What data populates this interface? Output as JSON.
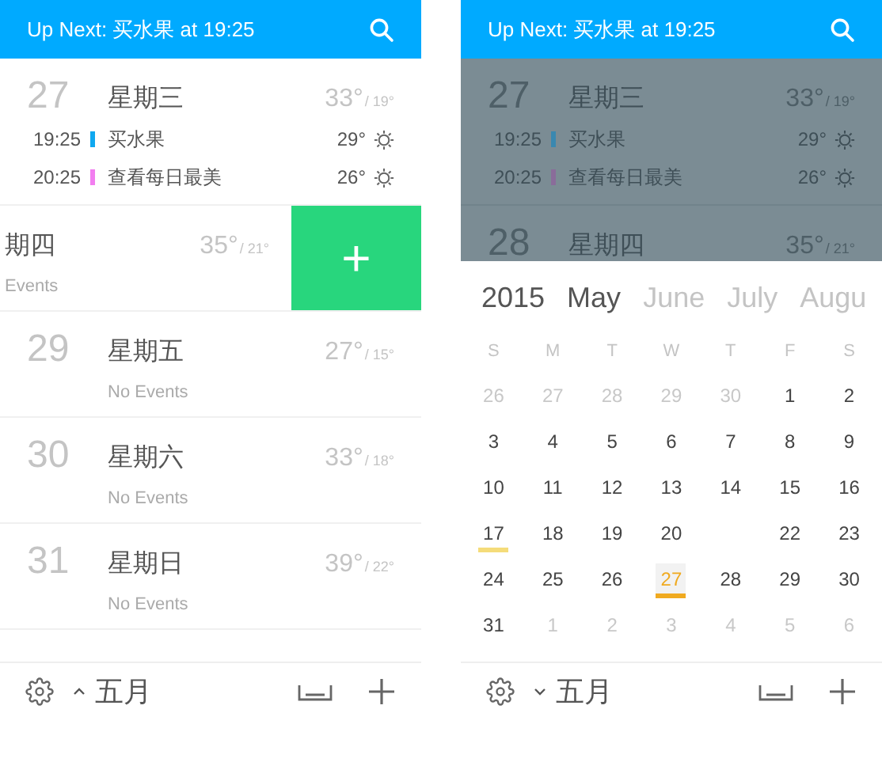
{
  "left_screen": {
    "header": {
      "title": "Up Next: 买水果 at 19:25"
    },
    "days": [
      {
        "day": "27",
        "weekday": "星期三",
        "high": "33°",
        "low": "/ 19°",
        "events": [
          {
            "time": "19:25",
            "title": "买水果",
            "color": "#10a8f0",
            "temp": "29°"
          },
          {
            "time": "20:25",
            "title": "查看每日最美",
            "color": "#f27ef0",
            "temp": "26°"
          }
        ]
      },
      {
        "kind": "swiped",
        "weekday": "期四",
        "note": "Events",
        "high": "35°",
        "low": "/ 21°",
        "action": "+"
      },
      {
        "day": "29",
        "weekday": "星期五",
        "note": "No Events",
        "high": "27°",
        "low": "/ 15°"
      },
      {
        "day": "30",
        "weekday": "星期六",
        "note": "No Events",
        "high": "33°",
        "low": "/ 18°"
      },
      {
        "day": "31",
        "weekday": "星期日",
        "note": "No Events",
        "high": "39°",
        "low": "/ 22°"
      }
    ],
    "bottom_bar": {
      "month": "五月",
      "expanded": false
    }
  },
  "right_screen": {
    "header": {
      "title": "Up Next: 买水果 at 19:25"
    },
    "list_dimmed": true,
    "days": [
      {
        "day": "27",
        "weekday": "星期三",
        "high": "33°",
        "low": "/ 19°",
        "events": [
          {
            "time": "19:25",
            "title": "买水果",
            "color": "#3a88b0",
            "temp": "29°"
          },
          {
            "time": "20:25",
            "title": "查看每日最美",
            "color": "#8a6c9a",
            "temp": "26°"
          }
        ]
      },
      {
        "day": "28",
        "weekday": "星期四",
        "high": "35°",
        "low": "/ 21°"
      }
    ],
    "calendar": {
      "year": "2015",
      "months": [
        {
          "label": "May",
          "selected": true
        },
        {
          "label": "June",
          "selected": false
        },
        {
          "label": "July",
          "selected": false
        },
        {
          "label": "Augu",
          "selected": false
        }
      ],
      "weekdays": [
        "S",
        "M",
        "T",
        "W",
        "T",
        "F",
        "S"
      ],
      "weeks": [
        [
          {
            "day": "26",
            "kind": "other",
            "selected": false
          },
          {
            "day": "27",
            "kind": "other",
            "selected": false
          },
          {
            "day": "28",
            "kind": "other",
            "selected": false
          },
          {
            "day": "29",
            "kind": "other",
            "selected": false
          },
          {
            "day": "30",
            "kind": "other",
            "selected": false
          },
          {
            "day": "1",
            "kind": "day",
            "selected": false
          },
          {
            "day": "2",
            "kind": "day",
            "selected": false
          }
        ],
        [
          {
            "day": "3",
            "kind": "day",
            "selected": false
          },
          {
            "day": "4",
            "kind": "day",
            "selected": false
          },
          {
            "day": "5",
            "kind": "day",
            "selected": false
          },
          {
            "day": "6",
            "kind": "day",
            "selected": false
          },
          {
            "day": "7",
            "kind": "day",
            "selected": false
          },
          {
            "day": "8",
            "kind": "day",
            "selected": false
          },
          {
            "day": "9",
            "kind": "day",
            "selected": false
          }
        ],
        [
          {
            "day": "10",
            "kind": "day",
            "selected": false
          },
          {
            "day": "11",
            "kind": "day",
            "selected": false
          },
          {
            "day": "12",
            "kind": "day",
            "selected": false
          },
          {
            "day": "13",
            "kind": "day",
            "selected": false
          },
          {
            "day": "14",
            "kind": "day",
            "selected": false
          },
          {
            "day": "15",
            "kind": "day",
            "selected": false
          },
          {
            "day": "16",
            "kind": "day",
            "selected": false
          }
        ],
        [
          {
            "day": "17",
            "kind": "marked",
            "selected": false
          },
          {
            "day": "18",
            "kind": "day",
            "selected": false
          },
          {
            "day": "19",
            "kind": "day",
            "selected": false
          },
          {
            "day": "20",
            "kind": "day",
            "selected": false
          },
          {
            "kind": "blank"
          },
          {
            "day": "22",
            "kind": "day",
            "selected": false
          },
          {
            "day": "23",
            "kind": "day",
            "selected": false
          }
        ],
        [
          {
            "day": "24",
            "kind": "day",
            "selected": false
          },
          {
            "day": "25",
            "kind": "day",
            "selected": false
          },
          {
            "day": "26",
            "kind": "day",
            "selected": false
          },
          {
            "day": "27",
            "kind": "day",
            "selected": true
          },
          {
            "day": "28",
            "kind": "day",
            "selected": false
          },
          {
            "day": "29",
            "kind": "day",
            "selected": false
          },
          {
            "day": "30",
            "kind": "day",
            "selected": false
          }
        ],
        [
          {
            "day": "31",
            "kind": "day",
            "selected": false
          },
          {
            "day": "1",
            "kind": "other",
            "selected": false
          },
          {
            "day": "2",
            "kind": "other",
            "selected": false
          },
          {
            "day": "3",
            "kind": "other",
            "selected": false
          },
          {
            "day": "4",
            "kind": "other",
            "selected": false
          },
          {
            "day": "5",
            "kind": "other",
            "selected": false
          },
          {
            "day": "6",
            "kind": "other",
            "selected": false
          }
        ]
      ]
    },
    "bottom_bar": {
      "month": "五月",
      "expanded": true
    }
  }
}
